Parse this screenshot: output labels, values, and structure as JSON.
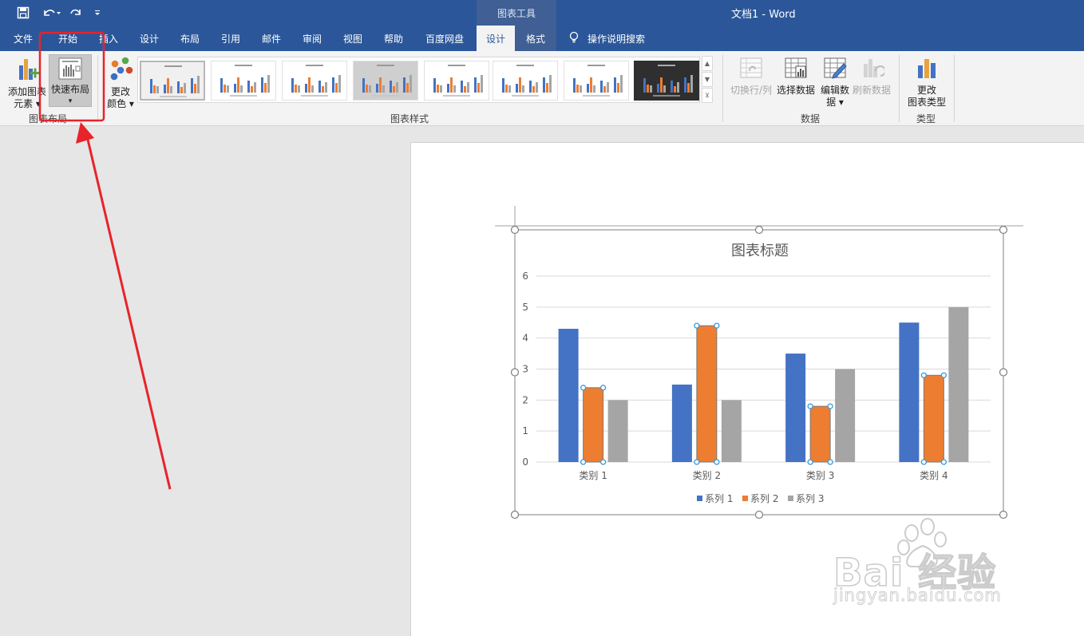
{
  "titlebar": {
    "context_tab": "图表工具",
    "doc_title": "文档1  -  Word"
  },
  "tabs": [
    {
      "label": "文件"
    },
    {
      "label": "开始"
    },
    {
      "label": "插入"
    },
    {
      "label": "设计"
    },
    {
      "label": "布局"
    },
    {
      "label": "引用"
    },
    {
      "label": "邮件"
    },
    {
      "label": "审阅"
    },
    {
      "label": "视图"
    },
    {
      "label": "帮助"
    },
    {
      "label": "百度网盘"
    },
    {
      "label": "设计"
    },
    {
      "label": "格式"
    }
  ],
  "tell_me": "操作说明搜索",
  "ribbon": {
    "add_element": [
      "添加图表",
      "元素 ▾"
    ],
    "quick_layout": [
      "快速布局",
      "▾"
    ],
    "change_colors": [
      "更改",
      "颜色 ▾"
    ],
    "group_layout_label": "图表布局",
    "group_styles_label": "图表样式",
    "switch_row_col": "切换行/列",
    "select_data": "选择数据",
    "edit_data": [
      "编辑数",
      "据 ▾"
    ],
    "refresh_data": "刷新数据",
    "group_data_label": "数据",
    "change_type": [
      "更改",
      "图表类型"
    ],
    "group_type_label": "类型"
  },
  "colors": {
    "word_blue": "#2b579a",
    "series1": "#4472c4",
    "series2": "#ed7d31",
    "series3": "#a5a5a5",
    "annotation_red": "#e8232a"
  },
  "chart_data": {
    "type": "bar",
    "title": "图表标题",
    "categories": [
      "类别 1",
      "类别 2",
      "类别 3",
      "类别 4"
    ],
    "series": [
      {
        "name": "系列 1",
        "values": [
          4.3,
          2.5,
          3.5,
          4.5
        ]
      },
      {
        "name": "系列 2",
        "values": [
          2.4,
          4.4,
          1.8,
          2.8
        ]
      },
      {
        "name": "系列 3",
        "values": [
          2,
          2,
          3,
          5
        ]
      }
    ],
    "ylim": [
      0,
      6
    ],
    "yticks": [
      "0",
      "1",
      "2",
      "3",
      "4",
      "5",
      "6"
    ],
    "grid": true,
    "legend": "bottom",
    "selected_series": "系列 2"
  },
  "watermark": {
    "brand": "Bai  经验",
    "url": "jingyan.baidu.com"
  }
}
